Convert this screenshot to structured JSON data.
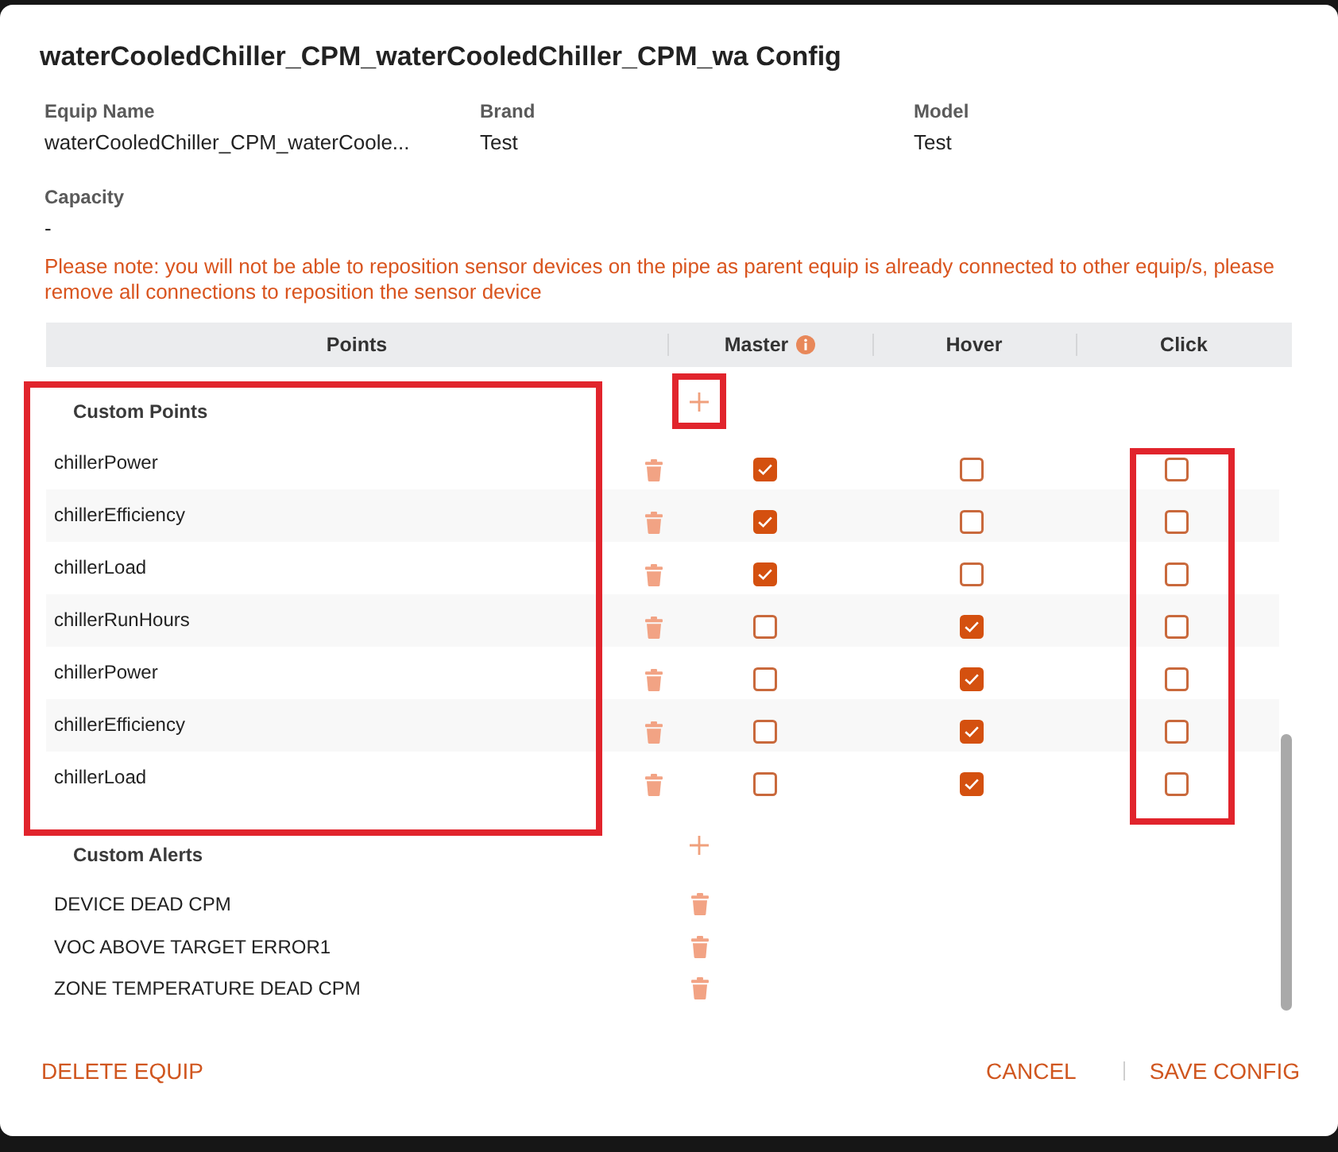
{
  "dialog": {
    "title": "waterCooledChiller_CPM_waterCooledChiller_CPM_wa Config"
  },
  "fields": [
    {
      "label": "Equip Name",
      "value": "waterCooledChiller_CPM_waterCoole..."
    },
    {
      "label": "Brand",
      "value": "Test"
    },
    {
      "label": "Model",
      "value": "Test"
    },
    {
      "label": "Capacity",
      "value": "-"
    }
  ],
  "note": "Please note: you will not be able to reposition sensor devices on the pipe as parent equip is already connected to other equip/s, please remove all connections to reposition the sensor device",
  "table": {
    "columns": [
      {
        "label": "Points",
        "info": false,
        "highlighted": false
      },
      {
        "label": "Master",
        "info": true,
        "highlighted": false
      },
      {
        "label": "Hover",
        "info": false,
        "highlighted": false
      },
      {
        "label": "Click",
        "info": false,
        "highlighted": true
      }
    ]
  },
  "custom_points": {
    "heading": "Custom Points",
    "highlighted": true,
    "add_highlighted": true,
    "rows": [
      {
        "name": "chillerPower",
        "master": true,
        "hover": false,
        "click": false
      },
      {
        "name": "chillerEfficiency",
        "master": true,
        "hover": false,
        "click": false
      },
      {
        "name": "chillerLoad",
        "master": true,
        "hover": false,
        "click": false
      },
      {
        "name": "chillerRunHours",
        "master": false,
        "hover": true,
        "click": false
      },
      {
        "name": "chillerPower",
        "master": false,
        "hover": true,
        "click": false
      },
      {
        "name": "chillerEfficiency",
        "master": false,
        "hover": true,
        "click": false
      },
      {
        "name": "chillerLoad",
        "master": false,
        "hover": true,
        "click": false
      }
    ]
  },
  "custom_alerts": {
    "heading": "Custom Alerts",
    "rows": [
      {
        "name": "DEVICE DEAD CPM"
      },
      {
        "name": "VOC ABOVE TARGET ERROR1"
      },
      {
        "name": "ZONE TEMPERATURE DEAD CPM"
      }
    ]
  },
  "footer": {
    "delete": "DELETE EQUIP",
    "cancel": "CANCEL",
    "save": "SAVE CONFIG"
  }
}
